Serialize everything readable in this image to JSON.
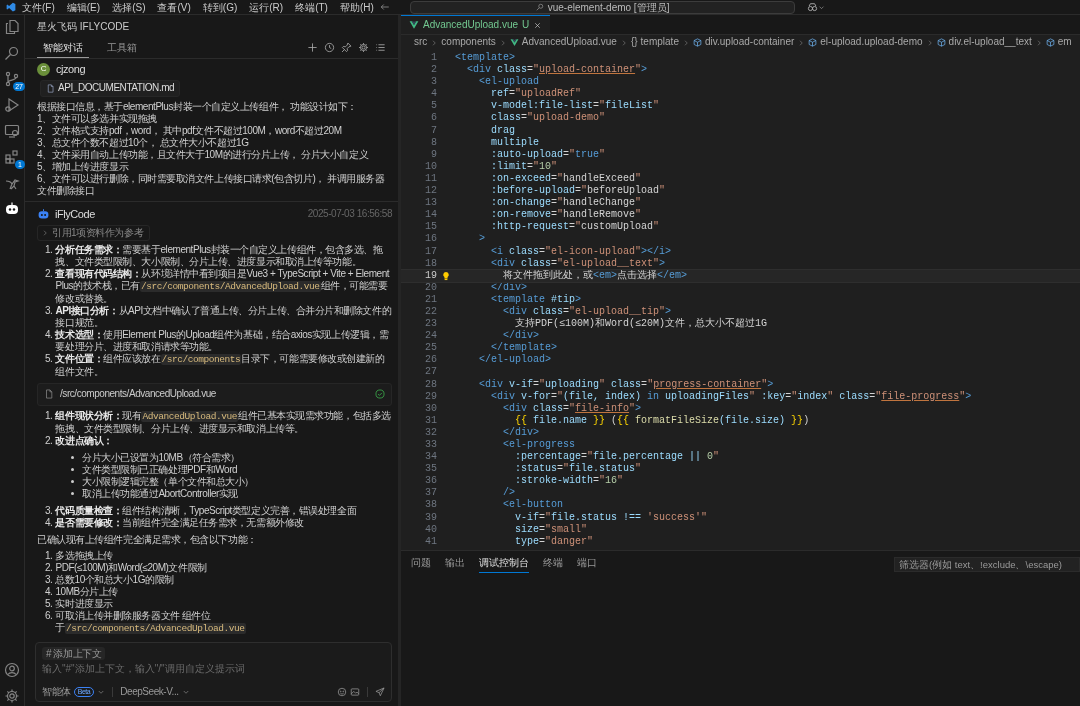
{
  "title_bar": {
    "menus": [
      "文件(F)",
      "编辑(E)",
      "选择(S)",
      "查看(V)",
      "转到(G)",
      "运行(R)",
      "终端(T)",
      "帮助(H)"
    ],
    "search": "vue-element-demo [管理员]"
  },
  "activity_bar": {
    "top": [
      {
        "kind": "files",
        "selected": false
      },
      {
        "kind": "search",
        "selected": false
      },
      {
        "kind": "scm",
        "selected": false,
        "badge": "27"
      },
      {
        "kind": "debug",
        "selected": false
      },
      {
        "kind": "remote",
        "selected": false
      },
      {
        "kind": "ext",
        "selected": false,
        "badge": "1"
      },
      {
        "kind": "animal",
        "selected": false
      },
      {
        "kind": "robot",
        "selected": true
      }
    ],
    "bottom": [
      {
        "kind": "account",
        "selected": false
      },
      {
        "kind": "settings",
        "selected": false
      }
    ]
  },
  "sidebar": {
    "title": "星火飞码 IFLYCODE",
    "tabs": [
      {
        "label": "智能对话",
        "selected": true
      },
      {
        "label": "工具箱",
        "selected": false
      }
    ],
    "toolbar": [
      {
        "kind": "plus"
      },
      {
        "kind": "history"
      },
      {
        "kind": "pin"
      },
      {
        "kind": "settings"
      },
      {
        "kind": "list"
      }
    ],
    "chat": {
      "user": {
        "initial": "C",
        "name": "cjzong",
        "attachment": "API_DOCUMENTATION.md",
        "lines": [
          "根据接口信息，基于elementPlus封装一个自定义上传组件， 功能设计如下：",
          "1、文件可以多选并实现拖拽",
          "2、文件格式支持pdf，word， 其中pdf文件不超过100M，word不超过20M",
          "3、总文件个数不超过10个， 总文件大小不超过1G",
          "4、文件采用自动上传功能，且文件大于10M的进行分片上传， 分片大小自定义",
          "5、增加上传进度显示",
          "6、文件可以进行删除，同时需要取消文件上传接口请求(包含切片)， 并调用服务器文件删除接口"
        ]
      },
      "reply": {
        "name": "iFlyCode",
        "time": "2025-07-03 16:56:58",
        "reference": {
          "label": "引用1项资料作为参考",
          "expanded": false
        },
        "steps": [
          {
            "number": "1.",
            "label": "分析任务需求：",
            "parts": [
              {
                "kind": "text",
                "text": "需要基于elementPlus封装一个自定义上传组件，包含多选、拖拽、文件类型限制、大小限制、分片上传、进度显示和取消上传等功能。"
              }
            ]
          },
          {
            "number": "2.",
            "label": "查看现有代码结构：",
            "parts": [
              {
                "kind": "text",
                "text": "从环境详情中看到项目是Vue3 + TypeScript + Vite + Element Plus的技术栈，已有"
              },
              {
                "kind": "code",
                "text": "/src/components/AdvancedUpload.vue"
              },
              {
                "kind": "text",
                "text": "组件，可能需要修改或替换。"
              }
            ]
          },
          {
            "number": "3.",
            "label": "API接口分析：",
            "parts": [
              {
                "kind": "text",
                "text": "从API文档中确认了普通上传、分片上传、合并分片和删除文件的接口规范。"
              }
            ]
          },
          {
            "number": "4.",
            "label": "技术选型：",
            "parts": [
              {
                "kind": "text",
                "text": "使用Element Plus的Upload组件为基础，结合axios实现上传逻辑，需要处理分片、进度和取消请求等功能。"
              }
            ]
          },
          {
            "number": "5.",
            "label": "文件位置：",
            "parts": [
              {
                "kind": "text",
                "text": "组件应该放在"
              },
              {
                "kind": "code",
                "text": "/src/components"
              },
              {
                "kind": "text",
                "text": "目录下，可能需要修改或创建新的组件文件。"
              }
            ]
          }
        ],
        "file_card": {
          "path": "/src/components/AdvancedUpload.vue",
          "done": true
        },
        "review": [
          {
            "number": "1.",
            "label": "组件现状分析：",
            "parts": [
              {
                "kind": "text",
                "text": "现有"
              },
              {
                "kind": "code",
                "text": "AdvancedUpload.vue"
              },
              {
                "kind": "text",
                "text": "组件已基本实现需求功能，包括多选拖拽、文件类型限制、分片上传、进度显示和取消上传等。"
              }
            ]
          },
          {
            "number": "2.",
            "label": "改进点确认：",
            "children": [
              {
                "text": "分片大小已设置为10MB（符合需求）"
              },
              {
                "text": "文件类型限制已正确处理PDF和Word"
              },
              {
                "text": "大小限制逻辑完整（单个文件和总大小）"
              },
              {
                "text": "取消上传功能通过AbortController实现"
              }
            ]
          },
          {
            "number": "3.",
            "label": "代码质量检查：",
            "parts": [
              {
                "kind": "text",
                "text": "组件结构清晰，TypeScript类型定义完善，错误处理全面"
              }
            ]
          },
          {
            "number": "4.",
            "label": "是否需要修改：",
            "parts": [
              {
                "kind": "text",
                "text": "当前组件完全满足任务需求，无需额外修改"
              }
            ]
          }
        ],
        "summary": "已确认现有上传组件完全满足需求，包含以下功能：",
        "features": [
          {
            "number": "1.",
            "parts": [
              {
                "kind": "text",
                "text": "多选拖拽上传"
              }
            ]
          },
          {
            "number": "2.",
            "parts": [
              {
                "kind": "text",
                "text": "PDF(≤100M)和Word(≤20M)文件限制"
              }
            ]
          },
          {
            "number": "3.",
            "parts": [
              {
                "kind": "text",
                "text": "总数10个和总大小1G的限制"
              }
            ]
          },
          {
            "number": "4.",
            "parts": [
              {
                "kind": "text",
                "text": "10MB分片上传"
              }
            ]
          },
          {
            "number": "5.",
            "parts": [
              {
                "kind": "text",
                "text": "实时进度显示"
              }
            ]
          },
          {
            "number": "6.",
            "parts": [
              {
                "kind": "text",
                "text": "可取消上传并删除服务器文件 组件位于"
              },
              {
                "kind": "code",
                "text": "/src/components/AdvancedUpload.vue"
              }
            ]
          }
        ]
      }
    },
    "composer": {
      "context_chip": "# 添加上下文",
      "placeholder": "输入\"#\"添加上下文，输入\"/\"调用自定义提示词",
      "agent": "智能体",
      "badge": "Beta",
      "model": "DeepSeek-V..."
    }
  },
  "editor": {
    "tab": {
      "label": "AdvancedUpload.vue",
      "status": "U",
      "selected": true
    },
    "breadcrumbs": [
      {
        "kind": "folder",
        "label": "src"
      },
      {
        "kind": "folder",
        "label": "components"
      },
      {
        "kind": "vue",
        "label": "AdvancedUpload.vue"
      },
      {
        "kind": "braces",
        "symbol": "{}",
        "label": "template"
      },
      {
        "kind": "element",
        "label": "div.upload-container"
      },
      {
        "kind": "element",
        "label": "el-upload.upload-demo"
      },
      {
        "kind": "element",
        "label": "div.el-upload__text"
      },
      {
        "kind": "element",
        "label": "em"
      }
    ],
    "lines": [
      {
        "number": "1",
        "current": false,
        "tokens": [
          {
            "kind": "tag",
            "text": "<template>"
          }
        ]
      },
      {
        "number": "2",
        "current": false,
        "tokens": [
          {
            "kind": "tag",
            "text": "  <div"
          },
          {
            "kind": "attr",
            "text": " class"
          },
          {
            "kind": "p",
            "text": "="
          },
          {
            "kind": "str",
            "text": "\""
          },
          {
            "kind": "link",
            "text": "upload-container"
          },
          {
            "kind": "str",
            "text": "\""
          },
          {
            "kind": "tag",
            "text": ">"
          }
        ]
      },
      {
        "number": "3",
        "current": false,
        "tokens": [
          {
            "kind": "tag",
            "text": "    <el-upload"
          }
        ]
      },
      {
        "number": "4",
        "current": false,
        "tokens": [
          {
            "kind": "attr",
            "text": "      ref"
          },
          {
            "kind": "p",
            "text": "="
          },
          {
            "kind": "str",
            "text": "\"uploadRef\""
          }
        ]
      },
      {
        "number": "5",
        "current": false,
        "tokens": [
          {
            "kind": "attr",
            "text": "      v-model:file-list"
          },
          {
            "kind": "p",
            "text": "="
          },
          {
            "kind": "str",
            "text": "\""
          },
          {
            "kind": "var",
            "text": "fileList"
          },
          {
            "kind": "str",
            "text": "\""
          }
        ]
      },
      {
        "number": "6",
        "current": false,
        "tokens": [
          {
            "kind": "attr",
            "text": "      class"
          },
          {
            "kind": "p",
            "text": "="
          },
          {
            "kind": "str",
            "text": "\"upload-demo\""
          }
        ]
      },
      {
        "number": "7",
        "current": false,
        "tokens": [
          {
            "kind": "attr",
            "text": "      drag"
          }
        ]
      },
      {
        "number": "8",
        "current": false,
        "tokens": [
          {
            "kind": "attr",
            "text": "      multiple"
          }
        ]
      },
      {
        "number": "9",
        "current": false,
        "tokens": [
          {
            "kind": "attr",
            "text": "      :auto-upload"
          },
          {
            "kind": "p",
            "text": "="
          },
          {
            "kind": "str",
            "text": "\""
          },
          {
            "kind": "kw",
            "text": "true"
          },
          {
            "kind": "str",
            "text": "\""
          }
        ]
      },
      {
        "number": "10",
        "current": false,
        "tokens": [
          {
            "kind": "attr",
            "text": "      :limit"
          },
          {
            "kind": "p",
            "text": "="
          },
          {
            "kind": "str",
            "text": "\""
          },
          {
            "kind": "num",
            "text": "10"
          },
          {
            "kind": "str",
            "text": "\""
          }
        ]
      },
      {
        "number": "11",
        "current": false,
        "tokens": [
          {
            "kind": "attr",
            "text": "      :on-exceed"
          },
          {
            "kind": "p",
            "text": "="
          },
          {
            "kind": "str",
            "text": "\""
          },
          {
            "kind": "text",
            "text": "handleExceed"
          },
          {
            "kind": "str",
            "text": "\""
          }
        ]
      },
      {
        "number": "12",
        "current": false,
        "tokens": [
          {
            "kind": "attr",
            "text": "      :before-upload"
          },
          {
            "kind": "p",
            "text": "="
          },
          {
            "kind": "str",
            "text": "\""
          },
          {
            "kind": "text",
            "text": "beforeUpload"
          },
          {
            "kind": "str",
            "text": "\""
          }
        ]
      },
      {
        "number": "13",
        "current": false,
        "tokens": [
          {
            "kind": "attr",
            "text": "      :on-change"
          },
          {
            "kind": "p",
            "text": "="
          },
          {
            "kind": "str",
            "text": "\""
          },
          {
            "kind": "text",
            "text": "handleChange"
          },
          {
            "kind": "str",
            "text": "\""
          }
        ]
      },
      {
        "number": "14",
        "current": false,
        "tokens": [
          {
            "kind": "attr",
            "text": "      :on-remove"
          },
          {
            "kind": "p",
            "text": "="
          },
          {
            "kind": "str",
            "text": "\""
          },
          {
            "kind": "text",
            "text": "handleRemove"
          },
          {
            "kind": "str",
            "text": "\""
          }
        ]
      },
      {
        "number": "15",
        "current": false,
        "tokens": [
          {
            "kind": "attr",
            "text": "      :http-request"
          },
          {
            "kind": "p",
            "text": "="
          },
          {
            "kind": "str",
            "text": "\""
          },
          {
            "kind": "text",
            "text": "customUpload"
          },
          {
            "kind": "str",
            "text": "\""
          }
        ]
      },
      {
        "number": "16",
        "current": false,
        "tokens": [
          {
            "kind": "tag",
            "text": "    >"
          }
        ]
      },
      {
        "number": "17",
        "current": false,
        "tokens": [
          {
            "kind": "tag",
            "text": "      <i"
          },
          {
            "kind": "attr",
            "text": " class"
          },
          {
            "kind": "p",
            "text": "="
          },
          {
            "kind": "str",
            "text": "\"el-icon-upload\""
          },
          {
            "kind": "tag",
            "text": "></i>"
          }
        ]
      },
      {
        "number": "18",
        "current": false,
        "tokens": [
          {
            "kind": "tag",
            "text": "      <div"
          },
          {
            "kind": "attr",
            "text": " class"
          },
          {
            "kind": "p",
            "text": "="
          },
          {
            "kind": "str",
            "text": "\"el-upload__text\""
          },
          {
            "kind": "tag",
            "text": ">"
          }
        ]
      },
      {
        "number": "19",
        "current": true,
        "tokens": [
          {
            "kind": "text",
            "text": "        将文件拖到此处，或"
          },
          {
            "kind": "tag",
            "text": "<em>"
          },
          {
            "kind": "text",
            "text": "点击选择"
          },
          {
            "kind": "tag",
            "text": "</em>"
          }
        ]
      },
      {
        "number": "20",
        "current": false,
        "tokens": [
          {
            "kind": "tag",
            "text": "      </div>"
          }
        ]
      },
      {
        "number": "21",
        "current": false,
        "tokens": [
          {
            "kind": "tag",
            "text": "      <template"
          },
          {
            "kind": "attr",
            "text": " #tip"
          },
          {
            "kind": "tag",
            "text": ">"
          }
        ]
      },
      {
        "number": "22",
        "current": false,
        "tokens": [
          {
            "kind": "tag",
            "text": "        <div"
          },
          {
            "kind": "attr",
            "text": " class"
          },
          {
            "kind": "p",
            "text": "="
          },
          {
            "kind": "str",
            "text": "\"el-upload__tip\""
          },
          {
            "kind": "tag",
            "text": ">"
          }
        ]
      },
      {
        "number": "23",
        "current": false,
        "tokens": [
          {
            "kind": "text",
            "text": "          支持PDF(≤100M)和Word(≤20M)文件，总大小不超过1G"
          }
        ]
      },
      {
        "number": "24",
        "current": false,
        "tokens": [
          {
            "kind": "tag",
            "text": "        </div>"
          }
        ]
      },
      {
        "number": "25",
        "current": false,
        "tokens": [
          {
            "kind": "tag",
            "text": "      </template>"
          }
        ]
      },
      {
        "number": "26",
        "current": false,
        "tokens": [
          {
            "kind": "tag",
            "text": "    </el-upload>"
          }
        ]
      },
      {
        "number": "27",
        "current": false
      },
      {
        "number": "28",
        "current": false,
        "tokens": [
          {
            "kind": "tag",
            "text": "    <div"
          },
          {
            "kind": "attr",
            "text": " v-if"
          },
          {
            "kind": "p",
            "text": "="
          },
          {
            "kind": "str",
            "text": "\""
          },
          {
            "kind": "var",
            "text": "uploading"
          },
          {
            "kind": "str",
            "text": "\""
          },
          {
            "kind": "attr",
            "text": " class"
          },
          {
            "kind": "p",
            "text": "="
          },
          {
            "kind": "str",
            "text": "\""
          },
          {
            "kind": "link",
            "text": "progress-container"
          },
          {
            "kind": "str",
            "text": "\""
          },
          {
            "kind": "tag",
            "text": ">"
          }
        ]
      },
      {
        "number": "29",
        "current": false,
        "tokens": [
          {
            "kind": "tag",
            "text": "      <div"
          },
          {
            "kind": "attr",
            "text": " v-for"
          },
          {
            "kind": "p",
            "text": "="
          },
          {
            "kind": "str",
            "text": "\""
          },
          {
            "kind": "var",
            "text": "(file, index) "
          },
          {
            "kind": "kw",
            "text": "in"
          },
          {
            "kind": "var",
            "text": " uploadingFiles"
          },
          {
            "kind": "str",
            "text": "\""
          },
          {
            "kind": "attr",
            "text": " :key"
          },
          {
            "kind": "p",
            "text": "="
          },
          {
            "kind": "str",
            "text": "\""
          },
          {
            "kind": "var",
            "text": "index"
          },
          {
            "kind": "str",
            "text": "\""
          },
          {
            "kind": "attr",
            "text": " class"
          },
          {
            "kind": "p",
            "text": "="
          },
          {
            "kind": "str",
            "text": "\""
          },
          {
            "kind": "link",
            "text": "file-progress"
          },
          {
            "kind": "str",
            "text": "\""
          },
          {
            "kind": "tag",
            "text": ">"
          }
        ]
      },
      {
        "number": "30",
        "current": false,
        "tokens": [
          {
            "kind": "tag",
            "text": "        <div"
          },
          {
            "kind": "attr",
            "text": " class"
          },
          {
            "kind": "p",
            "text": "="
          },
          {
            "kind": "str",
            "text": "\""
          },
          {
            "kind": "link",
            "text": "file-info"
          },
          {
            "kind": "str",
            "text": "\""
          },
          {
            "kind": "tag",
            "text": ">"
          }
        ]
      },
      {
        "number": "31",
        "current": false,
        "tokens": [
          {
            "kind": "brace",
            "text": "          {{"
          },
          {
            "kind": "var",
            "text": " file.name "
          },
          {
            "kind": "brace",
            "text": "}}"
          },
          {
            "kind": "text",
            "text": " ("
          },
          {
            "kind": "brace",
            "text": "{{"
          },
          {
            "kind": "fn",
            "text": " formatFileSize"
          },
          {
            "kind": "var",
            "text": "(file.size) "
          },
          {
            "kind": "brace",
            "text": "}}"
          },
          {
            "kind": "text",
            "text": ")"
          }
        ]
      },
      {
        "number": "32",
        "current": false,
        "tokens": [
          {
            "kind": "tag",
            "text": "        </div>"
          }
        ]
      },
      {
        "number": "33",
        "current": false,
        "tokens": [
          {
            "kind": "tag",
            "text": "        <el-progress"
          }
        ]
      },
      {
        "number": "34",
        "current": false,
        "tokens": [
          {
            "kind": "attr",
            "text": "          :percentage"
          },
          {
            "kind": "p",
            "text": "="
          },
          {
            "kind": "str",
            "text": "\""
          },
          {
            "kind": "var",
            "text": "file.percentage || "
          },
          {
            "kind": "num",
            "text": "0"
          },
          {
            "kind": "str",
            "text": "\""
          }
        ]
      },
      {
        "number": "35",
        "current": false,
        "tokens": [
          {
            "kind": "attr",
            "text": "          :status"
          },
          {
            "kind": "p",
            "text": "="
          },
          {
            "kind": "str",
            "text": "\""
          },
          {
            "kind": "var",
            "text": "file.status"
          },
          {
            "kind": "str",
            "text": "\""
          }
        ]
      },
      {
        "number": "36",
        "current": false,
        "tokens": [
          {
            "kind": "attr",
            "text": "          :stroke-width"
          },
          {
            "kind": "p",
            "text": "="
          },
          {
            "kind": "str",
            "text": "\""
          },
          {
            "kind": "num",
            "text": "16"
          },
          {
            "kind": "str",
            "text": "\""
          }
        ]
      },
      {
        "number": "37",
        "current": false,
        "tokens": [
          {
            "kind": "tag",
            "text": "        />"
          }
        ]
      },
      {
        "number": "38",
        "current": false,
        "tokens": [
          {
            "kind": "tag",
            "text": "        <el-button"
          }
        ]
      },
      {
        "number": "39",
        "current": false,
        "tokens": [
          {
            "kind": "attr",
            "text": "          v-if"
          },
          {
            "kind": "p",
            "text": "="
          },
          {
            "kind": "str",
            "text": "\""
          },
          {
            "kind": "var",
            "text": "file.status !== "
          },
          {
            "kind": "str",
            "text": "'success'"
          },
          {
            "kind": "str",
            "text": "\""
          }
        ]
      },
      {
        "number": "40",
        "current": false,
        "tokens": [
          {
            "kind": "attr",
            "text": "          size"
          },
          {
            "kind": "p",
            "text": "="
          },
          {
            "kind": "str",
            "text": "\"small\""
          }
        ]
      },
      {
        "number": "41",
        "current": false,
        "tokens": [
          {
            "kind": "attr",
            "text": "          type"
          },
          {
            "kind": "p",
            "text": "="
          },
          {
            "kind": "str",
            "text": "\"danger\""
          }
        ]
      }
    ]
  },
  "panel": {
    "tabs": [
      {
        "label": "问题",
        "selected": false
      },
      {
        "label": "输出",
        "selected": false
      },
      {
        "label": "调试控制台",
        "selected": true
      },
      {
        "label": "终端",
        "selected": false
      },
      {
        "label": "端口",
        "selected": false
      }
    ],
    "filter_placeholder": "筛选器(例如 text、!exclude、\\escape)"
  }
}
